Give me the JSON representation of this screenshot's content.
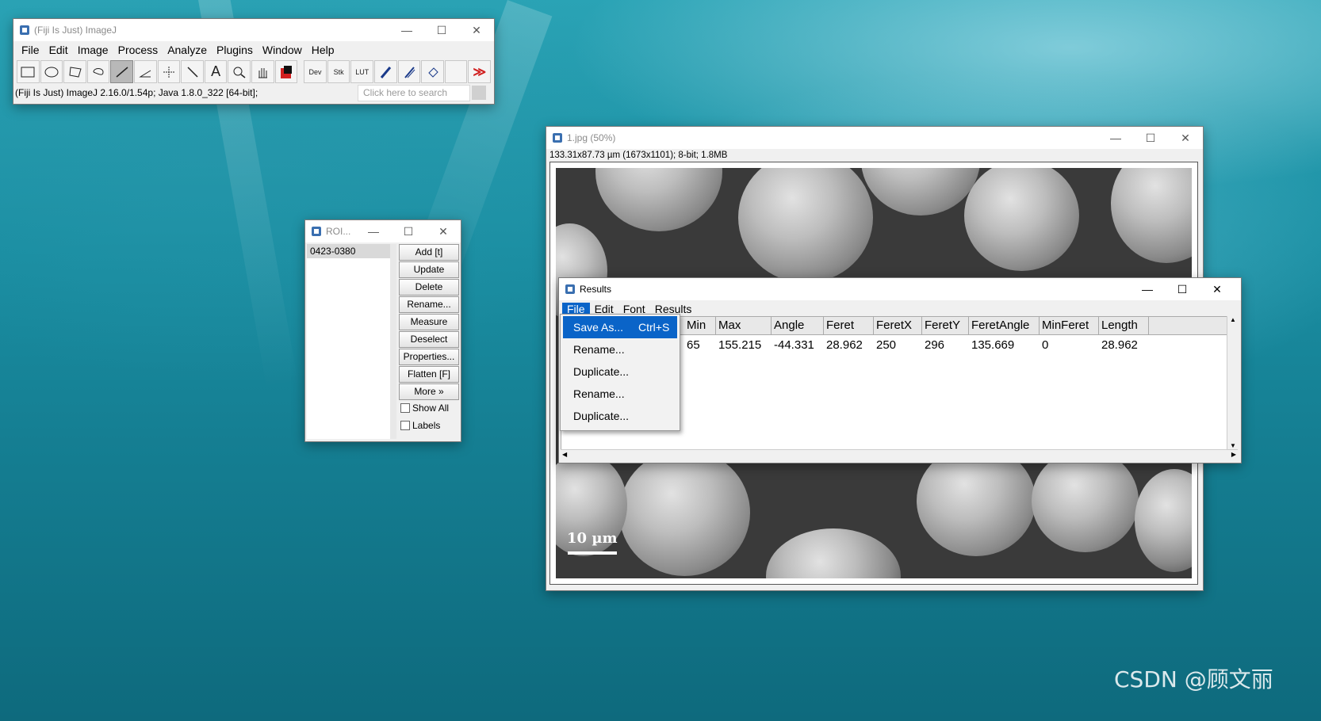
{
  "imagej": {
    "title": "(Fiji Is Just) ImageJ",
    "menu": [
      "File",
      "Edit",
      "Image",
      "Process",
      "Analyze",
      "Plugins",
      "Window",
      "Help"
    ],
    "tools": {
      "dev": "Dev",
      "stk": "Stk",
      "lut": "LUT",
      "text_tool": "A",
      "more": "≫"
    },
    "status": "(Fiji Is Just) ImageJ 2.16.0/1.54p; Java 1.8.0_322 [64-bit];",
    "search_placeholder": "Click here to search"
  },
  "roi_manager": {
    "title": "ROI...",
    "items": [
      "0423-0380"
    ],
    "buttons": [
      "Add [t]",
      "Update",
      "Delete",
      "Rename...",
      "Measure",
      "Deselect",
      "Properties...",
      "Flatten [F]",
      "More »"
    ],
    "checkboxes": [
      "Show All",
      "Labels"
    ]
  },
  "image_window": {
    "title": "1.jpg (50%)",
    "info": "133.31x87.73 µm (1673x1101); 8-bit; 1.8MB",
    "scale_label": "10 µm"
  },
  "results": {
    "title": "Results",
    "menu": [
      "File",
      "Edit",
      "Font",
      "Results"
    ],
    "columns": [
      "Min",
      "Max",
      "Angle",
      "Feret",
      "FeretX",
      "FeretY",
      "FeretAngle",
      "MinFeret",
      "Length"
    ],
    "row": [
      "65",
      "155.215",
      "-44.331",
      "28.962",
      "250",
      "296",
      "135.669",
      "0",
      "28.962"
    ],
    "file_menu": [
      {
        "label": "Save As...",
        "shortcut": "Ctrl+S"
      },
      {
        "label": "Rename...",
        "shortcut": ""
      },
      {
        "label": "Duplicate...",
        "shortcut": ""
      },
      {
        "label": "Rename...",
        "shortcut": ""
      },
      {
        "label": "Duplicate...",
        "shortcut": ""
      }
    ]
  },
  "window_controls": {
    "minimize": "—",
    "maximize": "☐",
    "close": "✕"
  },
  "watermark": "CSDN @顾文丽",
  "colors": {
    "menu_highlight": "#0a64c8",
    "desktop": "#1a8ea2"
  }
}
